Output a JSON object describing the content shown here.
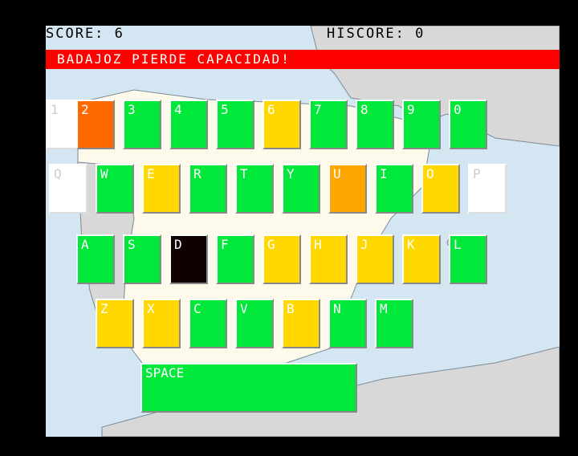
{
  "hud": {
    "score": "SCORE: 6",
    "hiscore": "HISCORE: 0"
  },
  "banner": "Badajoz pierde capacidad!",
  "colors": {
    "green": "#00e83a",
    "yellow": "#ffd800",
    "orange": "#ffa600",
    "red_orange": "#ff6a00",
    "white": "#ffffff",
    "dark": "#100000",
    "banner": "#ff0000",
    "sea": "#d4e6f1",
    "land": "#d8d8d8",
    "peninsula": "#fdfaec"
  },
  "keyboard": {
    "row1": [
      {
        "label": "1",
        "state": "white"
      },
      {
        "label": "2",
        "state": "red-orange"
      },
      {
        "label": "3",
        "state": "green"
      },
      {
        "label": "4",
        "state": "green"
      },
      {
        "label": "5",
        "state": "green"
      },
      {
        "label": "6",
        "state": "yellow"
      },
      {
        "label": "7",
        "state": "green"
      },
      {
        "label": "8",
        "state": "green"
      },
      {
        "label": "9",
        "state": "green"
      },
      {
        "label": "0",
        "state": "green"
      }
    ],
    "row2": [
      {
        "label": "Q",
        "state": "white"
      },
      {
        "label": "W",
        "state": "green"
      },
      {
        "label": "E",
        "state": "yellow"
      },
      {
        "label": "R",
        "state": "green"
      },
      {
        "label": "T",
        "state": "green"
      },
      {
        "label": "Y",
        "state": "green"
      },
      {
        "label": "U",
        "state": "orange"
      },
      {
        "label": "I",
        "state": "green"
      },
      {
        "label": "O",
        "state": "yellow"
      },
      {
        "label": "P",
        "state": "white"
      }
    ],
    "row3": [
      {
        "label": "A",
        "state": "green"
      },
      {
        "label": "S",
        "state": "green"
      },
      {
        "label": "D",
        "state": "dark"
      },
      {
        "label": "F",
        "state": "green"
      },
      {
        "label": "G",
        "state": "yellow"
      },
      {
        "label": "H",
        "state": "yellow"
      },
      {
        "label": "J",
        "state": "yellow"
      },
      {
        "label": "K",
        "state": "yellow"
      },
      {
        "label": "L",
        "state": "green"
      }
    ],
    "row4": [
      {
        "label": "Z",
        "state": "yellow"
      },
      {
        "label": "X",
        "state": "yellow"
      },
      {
        "label": "C",
        "state": "green"
      },
      {
        "label": "V",
        "state": "green"
      },
      {
        "label": "B",
        "state": "yellow"
      },
      {
        "label": "N",
        "state": "green"
      },
      {
        "label": "M",
        "state": "green"
      }
    ],
    "space": {
      "label": "SPACE",
      "state": "green"
    }
  }
}
